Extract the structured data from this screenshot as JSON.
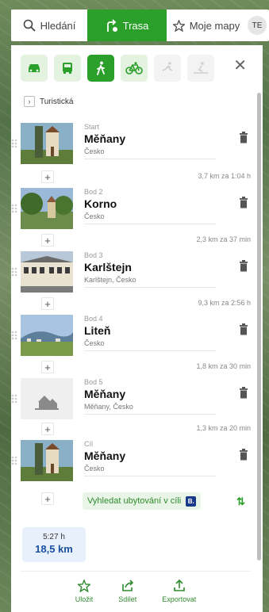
{
  "nav": {
    "search_label": "Hledání",
    "route_label": "Trasa",
    "maps_label": "Moje mapy",
    "avatar_initials": "TE"
  },
  "route_type": {
    "label": "Turistická"
  },
  "stops": [
    {
      "label": "Start",
      "name": "Měňany",
      "sub": "Česko"
    },
    {
      "label": "Bod 2",
      "name": "Korno",
      "sub": "Česko"
    },
    {
      "label": "Bod 3",
      "name": "Karlštejn",
      "sub": "Karlštejn, Česko"
    },
    {
      "label": "Bod 4",
      "name": "Liteň",
      "sub": "Česko"
    },
    {
      "label": "Bod 5",
      "name": "Měňany",
      "sub": "Měňany, Česko"
    },
    {
      "label": "Cíl",
      "name": "Měňany",
      "sub": "Česko"
    }
  ],
  "segments": [
    "3,7 km za 1:04 h",
    "2,3 km za 37 min",
    "9,3 km za 2:56 h",
    "1,8 km za 30 min",
    "1,3 km za 20 min"
  ],
  "lodging": {
    "label": "Vyhledat ubytování v cíli",
    "badge": "B."
  },
  "summary": {
    "time": "5:27 h",
    "distance": "18,5 km"
  },
  "actions": {
    "save": "Uložit",
    "share": "Sdílet",
    "export": "Exportovat"
  },
  "colors": {
    "accent": "#2aa02a",
    "distance": "#1a4fa0",
    "booking": "#1b3a8c"
  },
  "icons": [
    "search-icon",
    "route-icon",
    "star-icon",
    "car-icon",
    "bus-icon",
    "walk-icon",
    "bike-icon",
    "run-icon",
    "ski-icon",
    "close-icon",
    "trash-icon",
    "plus-icon",
    "swap-icon",
    "share-icon",
    "export-icon"
  ]
}
